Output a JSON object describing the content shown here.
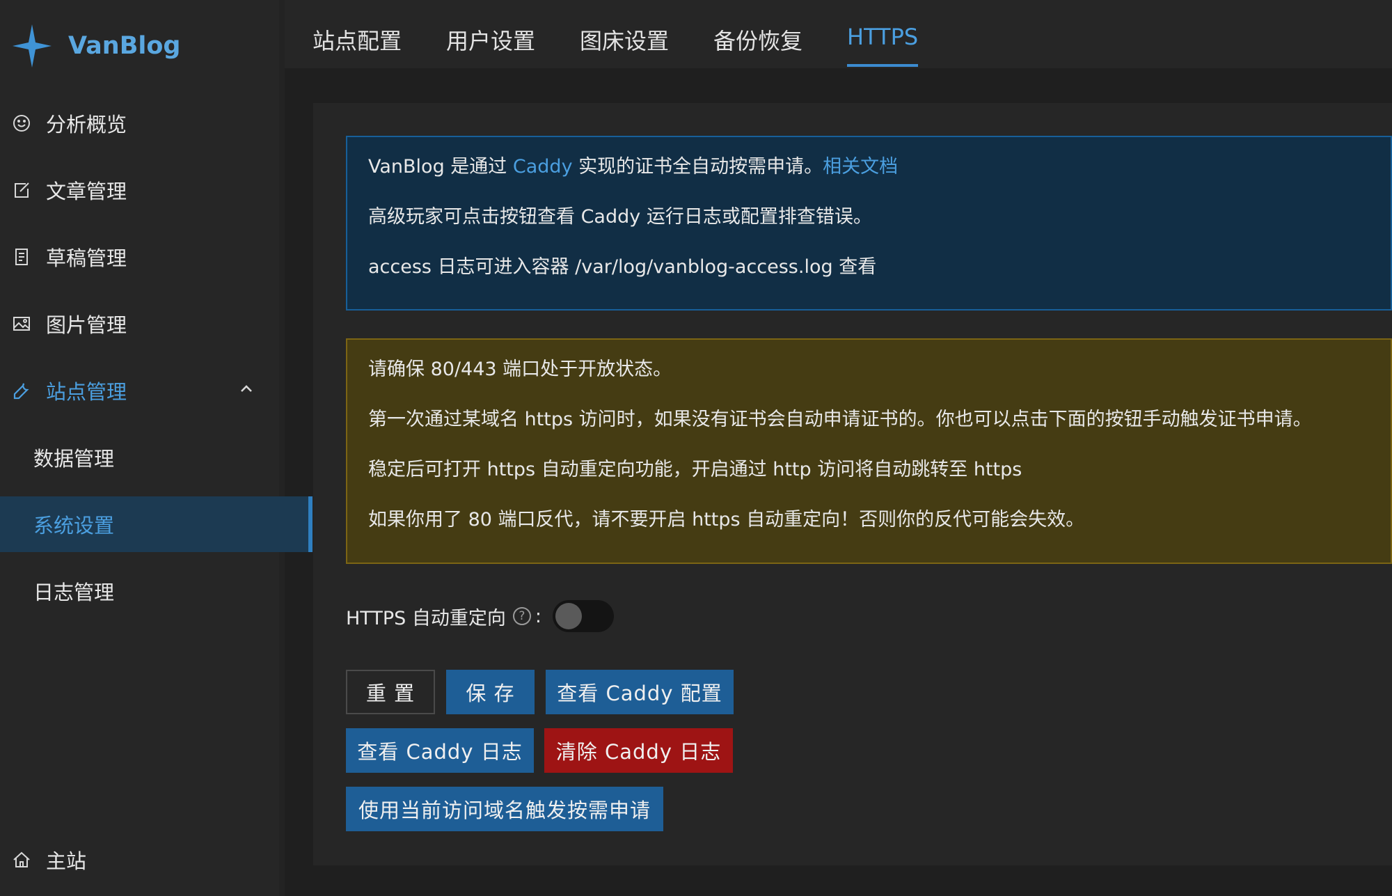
{
  "brand": {
    "name": "VanBlog",
    "accent": "#4b9fe0"
  },
  "sidebar": {
    "items": [
      {
        "label": "分析概览",
        "icon": "smile-icon"
      },
      {
        "label": "文章管理",
        "icon": "edit-icon"
      },
      {
        "label": "草稿管理",
        "icon": "file-icon"
      },
      {
        "label": "图片管理",
        "icon": "picture-icon"
      },
      {
        "label": "站点管理",
        "icon": "tool-icon",
        "expanded": true
      },
      {
        "label": "数据管理"
      },
      {
        "label": "系统设置",
        "selected": true
      },
      {
        "label": "日志管理"
      }
    ],
    "footer": {
      "label": "主站",
      "icon": "home-icon"
    }
  },
  "tabs": [
    {
      "label": "站点配置"
    },
    {
      "label": "用户设置"
    },
    {
      "label": "图床设置"
    },
    {
      "label": "备份恢复"
    },
    {
      "label": "HTTPS",
      "active": true
    }
  ],
  "info_alert": {
    "line1_pre": "VanBlog 是通过 ",
    "line1_link": "Caddy",
    "line1_mid": " 实现的证书全自动按需申请。",
    "line1_doc_link": "相关文档",
    "line2": "高级玩家可点击按钮查看 Caddy 运行日志或配置排查错误。",
    "line3": "access 日志可进入容器 /var/log/vanblog-access.log 查看"
  },
  "warn_alert": {
    "line1": "请确保 80/443 端口处于开放状态。",
    "line2": "第一次通过某域名 https 访问时，如果没有证书会自动申请证书的。你也可以点击下面的按钮手动触发证书申请。",
    "line3": "稳定后可打开 https 自动重定向功能，开启通过 http 访问将自动跳转至 https",
    "line4": "如果你用了 80 端口反代，请不要开启 https 自动重定向！否则你的反代可能会失效。"
  },
  "form": {
    "redirect_label": "HTTPS 自动重定向",
    "help_glyph": "?",
    "colon": ":",
    "redirect_enabled": false
  },
  "buttons": {
    "reset": "重 置",
    "save": "保 存",
    "view_config": "查看 Caddy 配置",
    "view_log": "查看 Caddy 日志",
    "clear_log": "清除 Caddy 日志",
    "trigger_apply": "使用当前访问域名触发按需申请"
  }
}
